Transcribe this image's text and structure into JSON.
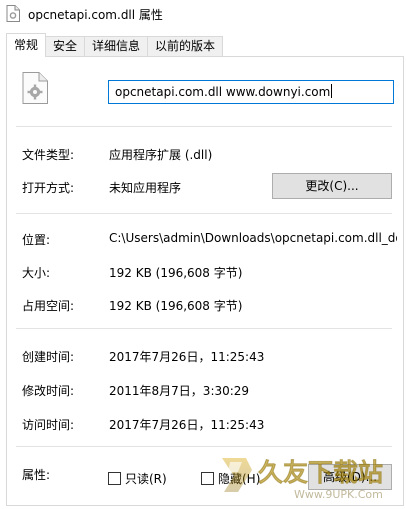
{
  "window": {
    "title": "opcnetapi.com.dll 属性",
    "file_icon": "dll-gear-file-icon"
  },
  "tabs": [
    {
      "label": "常规",
      "active": true
    },
    {
      "label": "安全",
      "active": false
    },
    {
      "label": "详细信息",
      "active": false
    },
    {
      "label": "以前的版本",
      "active": false
    }
  ],
  "general": {
    "file_name_value": "opcnetapi.com.dll www.downyi.com",
    "file_type_label": "文件类型:",
    "file_type_value": "应用程序扩展 (.dll)",
    "opens_with_label": "打开方式:",
    "opens_with_value": "未知应用程序",
    "change_button": "更改(C)...",
    "location_label": "位置:",
    "location_value": "C:\\Users\\admin\\Downloads\\opcnetapi.com.dll_do",
    "size_label": "大小:",
    "size_value": "192 KB (196,608 字节)",
    "size_on_disk_label": "占用空间:",
    "size_on_disk_value": "192 KB (196,608 字节)",
    "created_label": "创建时间:",
    "created_value": "2017年7月26日，11:25:43",
    "modified_label": "修改时间:",
    "modified_value": "2011年8月7日，3:30:29",
    "accessed_label": "访问时间:",
    "accessed_value": "2017年7月26日，11:25:43",
    "attributes_label": "属性:",
    "readonly_label": "只读(R)",
    "readonly_checked": false,
    "hidden_label": "隐藏(H)",
    "hidden_checked": false,
    "advanced_button": "高级(D)..."
  },
  "watermark": {
    "brand": "久友下载站",
    "url": "Www.9UPK.Com"
  }
}
